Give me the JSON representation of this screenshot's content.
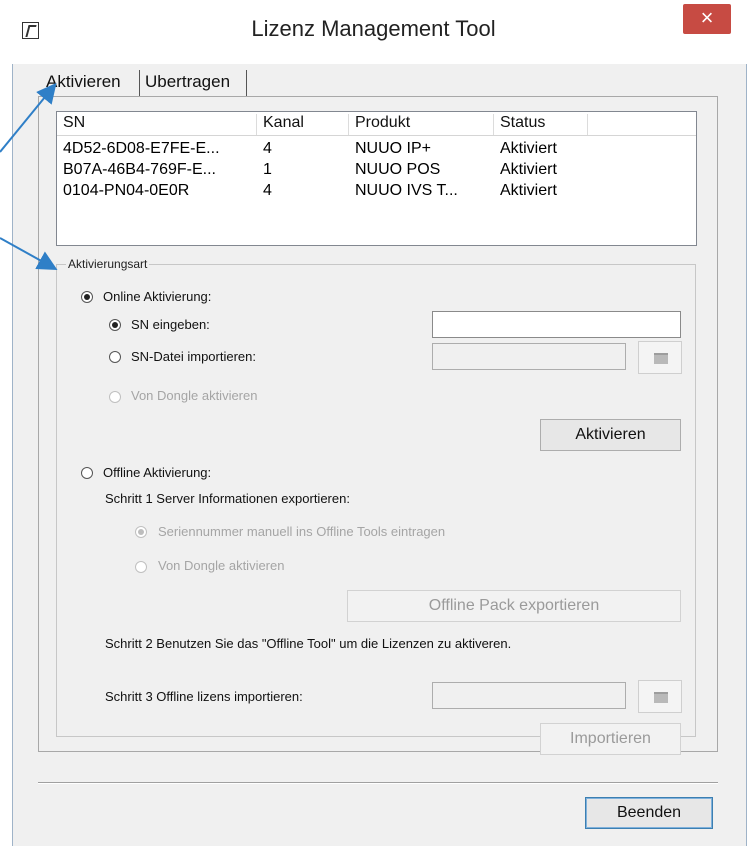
{
  "window": {
    "title": "Lizenz Management Tool",
    "close_glyph": "×",
    "icon": "app-icon"
  },
  "tabs": [
    {
      "label": "Aktivieren",
      "active": true
    },
    {
      "label": "Ubertragen",
      "active": false
    }
  ],
  "license_list": {
    "columns": [
      "SN",
      "Kanal",
      "Produkt",
      "Status"
    ],
    "rows": [
      {
        "sn": "4D52-6D08-E7FE-E...",
        "kanal": "4",
        "produkt": "NUUO IP+",
        "status": "Aktiviert"
      },
      {
        "sn": "B07A-46B4-769F-E...",
        "kanal": "1",
        "produkt": "NUUO POS",
        "status": "Aktiviert"
      },
      {
        "sn": "0104-PN04-0E0R",
        "kanal": "4",
        "produkt": "NUUO IVS T...",
        "status": "Aktiviert"
      }
    ]
  },
  "activation": {
    "group_title": "Aktivierungsart",
    "online_label": "Online Aktivierung:",
    "sn_eingeben_label": "SN eingeben:",
    "sn_value": "",
    "sn_datei_label": "SN-Datei importieren:",
    "sn_datei_value": "",
    "dongle_label": "Von Dongle aktivieren",
    "activate_button": "Aktivieren",
    "offline_label": "Offline Aktivierung:",
    "step1_label": "Schritt 1  Server Informationen exportieren:",
    "step1_manual_label": "Seriennummer manuell ins Offline Tools eintragen",
    "step1_dongle_label": "Von Dongle aktivieren",
    "export_button": "Offline Pack exportieren",
    "step2_label": "Schritt 2  Benutzen Sie das \"Offline Tool\" um die Lizenzen zu aktiveren.",
    "step3_label": "Schritt 3  Offline lizens importieren:",
    "step3_value": "",
    "import_button": "Importieren"
  },
  "footer": {
    "close_button": "Beenden"
  },
  "colors": {
    "close_red": "#c74b43",
    "annotation_blue": "#2f7fc7"
  }
}
